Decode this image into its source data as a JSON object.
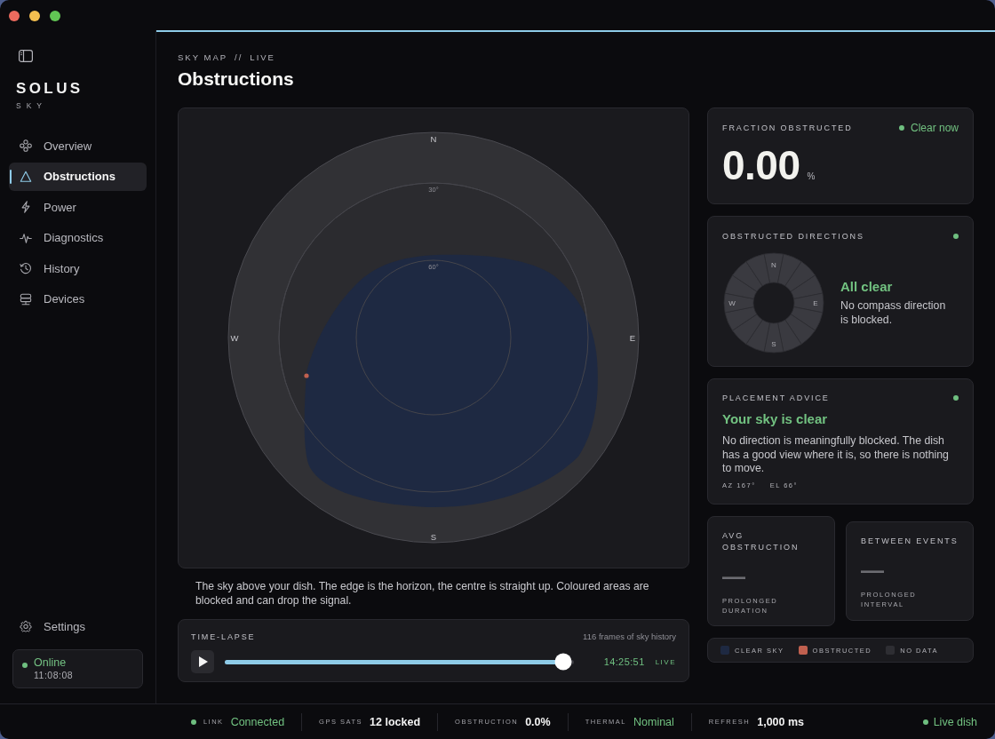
{
  "sidebar": {
    "brand": {
      "name": "SOLUS",
      "tagline": "SKY"
    },
    "items": [
      {
        "label": "Overview",
        "selected": false
      },
      {
        "label": "Obstructions",
        "selected": true
      },
      {
        "label": "Power",
        "selected": false
      },
      {
        "label": "Diagnostics",
        "selected": false
      },
      {
        "label": "History",
        "selected": false
      },
      {
        "label": "Devices",
        "selected": false
      }
    ],
    "settings": {
      "label": "Settings"
    },
    "connection": {
      "status": "Online",
      "time": "11:08:08",
      "online": true
    }
  },
  "header": {
    "section": "SKY MAP",
    "separator": "//",
    "view": "LIVE",
    "title": "Obstructions"
  },
  "sky_map": {
    "directions": [
      "N",
      "E",
      "S",
      "W"
    ],
    "rings": [
      "30°",
      "60°"
    ],
    "caption": "The sky above your dish. The edge is the horizon, the centre is straight up. Coloured areas are blocked and can drop the signal."
  },
  "time_lapse": {
    "title": "TIME-LAPSE",
    "frames": "116 frames of sky history",
    "level": 0.97,
    "time": "14:25:51",
    "live": "LIVE"
  },
  "fraction": {
    "title": "FRACTION OBSTRUCTED",
    "status": "Clear now",
    "value": "0.00",
    "unit": "%"
  },
  "directions": {
    "title": "OBSTRUCTED DIRECTIONS",
    "compass": [
      "N",
      "E",
      "S",
      "W"
    ],
    "sectors": [
      {
        "blocked": false
      },
      {
        "blocked": false
      },
      {
        "blocked": false
      },
      {
        "blocked": false
      },
      {
        "blocked": false
      },
      {
        "blocked": false
      },
      {
        "blocked": false
      },
      {
        "blocked": false
      },
      {
        "blocked": false
      },
      {
        "blocked": false
      },
      {
        "blocked": false
      },
      {
        "blocked": false
      },
      {
        "blocked": false
      },
      {
        "blocked": false
      },
      {
        "blocked": false
      },
      {
        "blocked": false
      }
    ],
    "headline": "All clear",
    "text": "No compass direction is blocked."
  },
  "advice": {
    "title": "PLACEMENT ADVICE",
    "headline": "Your sky is clear",
    "text": "No direction is meaningfully blocked. The dish has a good view where it is, so there is nothing to move.",
    "azimuth": "AZ 167°",
    "elevation": "EL 66°"
  },
  "stats": [
    {
      "title": "AVG OBSTRUCTION",
      "value": "—",
      "label": "PROLONGED DURATION"
    },
    {
      "title": "BETWEEN EVENTS",
      "value": "—",
      "label": "PROLONGED INTERVAL"
    }
  ],
  "legend": [
    {
      "label": "CLEAR SKY",
      "color": "#1e2942"
    },
    {
      "label": "OBSTRUCTED",
      "color": "#c0604f"
    },
    {
      "label": "NO DATA",
      "color": "#2e2e33"
    }
  ],
  "status_bar": {
    "items": [
      {
        "label": "LINK",
        "value": "Connected",
        "good": true,
        "dot": true
      },
      {
        "label": "GPS SATS",
        "value": "12 locked",
        "good": false,
        "dot": false
      },
      {
        "label": "OBSTRUCTION",
        "value": "0.0%",
        "good": false,
        "dot": false
      },
      {
        "label": "THERMAL",
        "value": "Nominal",
        "good": true,
        "dot": false
      },
      {
        "label": "REFRESH",
        "value": "1,000 ms",
        "good": false,
        "dot": false
      }
    ],
    "live": "Live dish"
  }
}
